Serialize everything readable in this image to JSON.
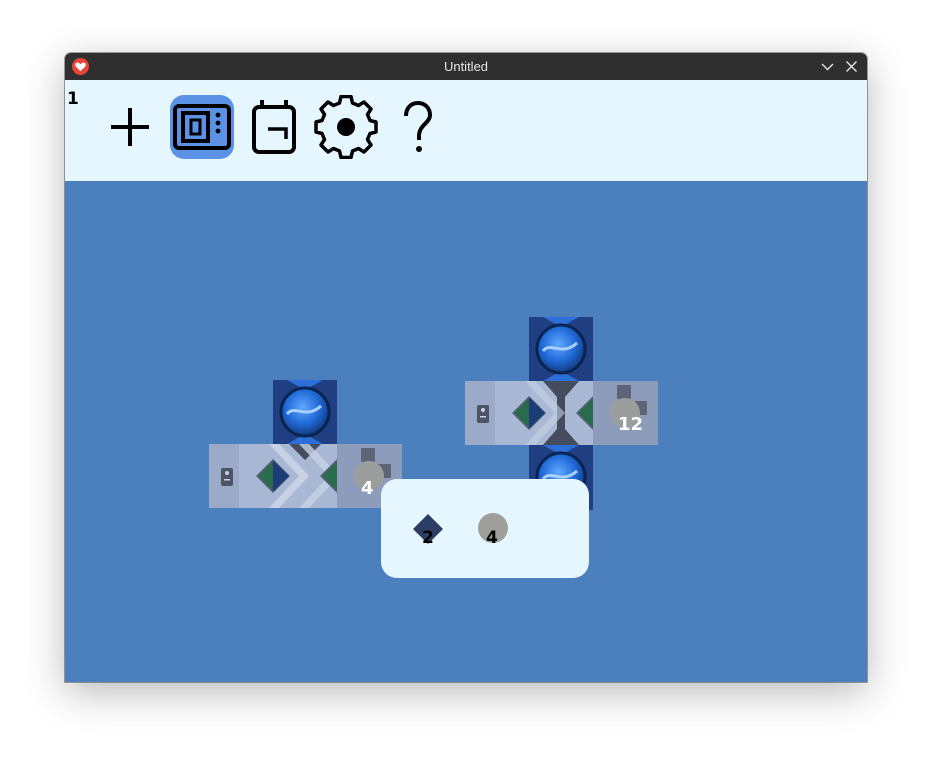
{
  "window": {
    "title": "Untitled"
  },
  "toolbar": {
    "level": "1",
    "tools": [
      {
        "name": "add",
        "icon": "plus-icon",
        "active": false
      },
      {
        "name": "machine",
        "icon": "machine-icon",
        "active": true
      },
      {
        "name": "inventory",
        "icon": "backpack-icon",
        "active": false
      },
      {
        "name": "settings",
        "icon": "gear-icon",
        "active": false
      },
      {
        "name": "help",
        "icon": "question-icon",
        "active": false
      }
    ]
  },
  "machines": [
    {
      "name": "machine-left",
      "output_count": "4"
    },
    {
      "name": "machine-right",
      "output_count": "12"
    }
  ],
  "popup": {
    "items": [
      {
        "icon": "diamond-icon",
        "count": "2"
      },
      {
        "icon": "circle-icon",
        "count": "4"
      }
    ]
  },
  "colors": {
    "titlebar": "#2f2f30",
    "toolbar": "#e6f6fe",
    "canvas": "#4b7fbd",
    "active_tool": "#5b92e5",
    "tile_dark": "#1f3f82",
    "tile_light": "#a9b8d4",
    "diamond_green": "#2c6a4e",
    "diamond_navy": "#1c3d78"
  }
}
